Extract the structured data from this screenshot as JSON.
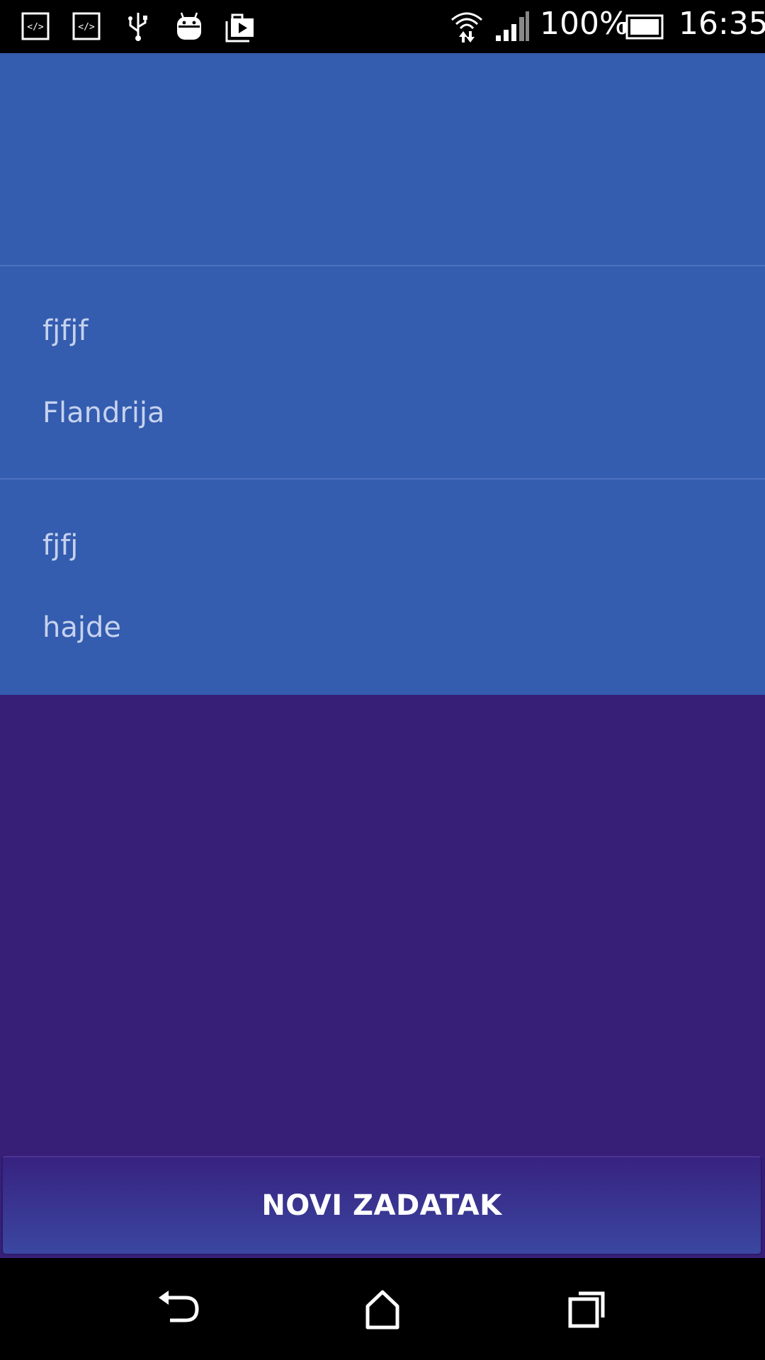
{
  "status_bar": {
    "icons_left": [
      "code-icon",
      "code-icon",
      "usb-icon",
      "android-debug-icon",
      "media-store-icon"
    ],
    "icons_right": [
      "wifi-icon",
      "signal-icon",
      "battery-icon"
    ],
    "battery_text": "100%",
    "time": "16:35"
  },
  "list": {
    "items": [
      {
        "title": "",
        "subtitle": ""
      },
      {
        "title": "fjfjf",
        "subtitle": "Flandrija"
      },
      {
        "title": "fjfj",
        "subtitle": "hajde"
      }
    ]
  },
  "button": {
    "label": "NOVI ZADATAK"
  },
  "nav_bar": {
    "icons": [
      "back-icon",
      "home-icon",
      "recents-icon"
    ]
  },
  "colors": {
    "list_background": "#345caf",
    "page_background": "#371f78",
    "item_text": "#c6d2ee",
    "divider": "#4d73c1"
  }
}
